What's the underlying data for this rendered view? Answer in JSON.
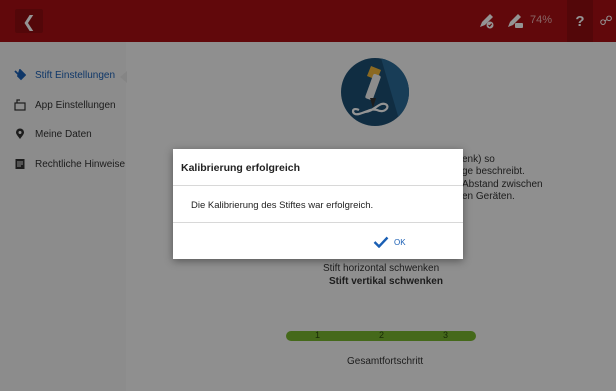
{
  "topbar": {
    "back_icon": "chevron-left-icon",
    "battery_text": "74%",
    "help_label": "?",
    "icons": [
      "pen-status-icon",
      "pen-battery-icon",
      "help-icon",
      "link-icon"
    ]
  },
  "sidebar": {
    "items": [
      {
        "label": "Stift Einstellungen",
        "icon": "pen-settings-icon",
        "active": true
      },
      {
        "label": "App Einstellungen",
        "icon": "app-settings-icon",
        "active": false
      },
      {
        "label": "Meine Daten",
        "icon": "location-pin-icon",
        "active": false
      },
      {
        "label": "Rechtliche Hinweise",
        "icon": "document-icon",
        "active": false
      }
    ]
  },
  "main": {
    "instruction_lines": [
      "enk) so",
      "ge beschreibt.",
      "Abstand zwischen",
      "en Geräten."
    ],
    "step_horizontal": "Stift horizontal schwenken",
    "step_vertical": "Stift vertikal schwenken",
    "progress": {
      "steps": [
        "1",
        "2",
        "3"
      ],
      "label": "Gesamtfortschritt",
      "color": "#77b52e"
    }
  },
  "dialog": {
    "title": "Kalibrierung erfolgreich",
    "message": "Die Kalibrierung des Stiftes war erfolgreich.",
    "ok_label": "OK"
  },
  "colors": {
    "topbar": "#a80f13",
    "accent": "#1a5fb4",
    "progress": "#77b52e"
  }
}
